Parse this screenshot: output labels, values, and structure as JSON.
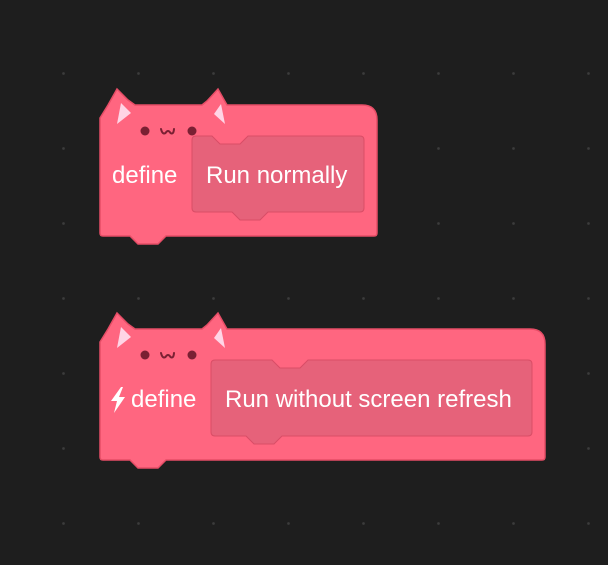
{
  "workspace": {
    "background": "#1e1e1e",
    "grid_dot_color": "#3c3c3c"
  },
  "colors": {
    "block_fill": "#ff6680",
    "block_stroke": "#e64d66",
    "slot_fill": "#e6627a",
    "ear_inner": "#ffd5e6",
    "face": "#7a2033"
  },
  "blocks": [
    {
      "define_label": "define",
      "custom_block_label": "Run normally",
      "run_without_refresh": false
    },
    {
      "define_label": "define",
      "custom_block_label": "Run without screen refresh",
      "run_without_refresh": true,
      "warp_icon": "lightning-bolt-icon"
    }
  ]
}
